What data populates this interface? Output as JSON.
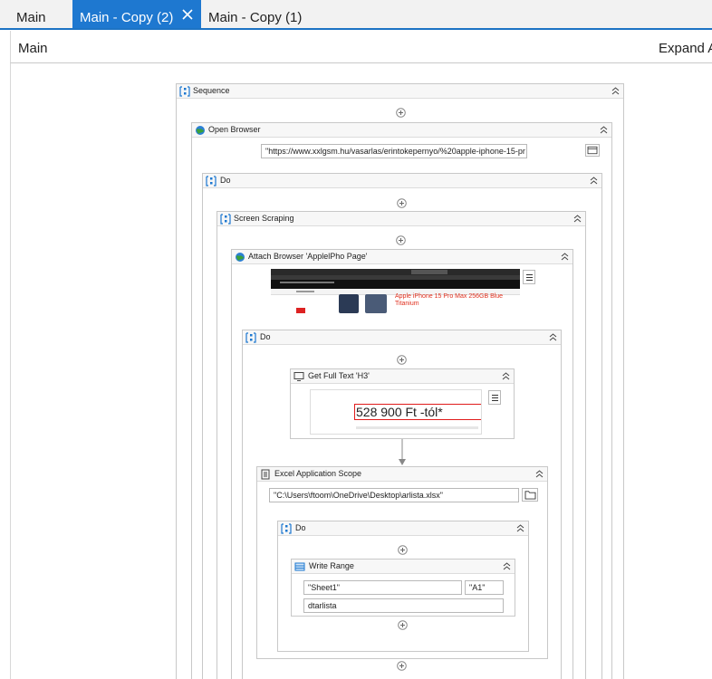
{
  "tabs": [
    {
      "label": "Main",
      "active": false
    },
    {
      "label": "Main - Copy (2)",
      "active": true
    },
    {
      "label": "Main - Copy (1)",
      "active": false
    }
  ],
  "header": {
    "title": "Main",
    "expand_label": "Expand A"
  },
  "workflow": {
    "sequence": {
      "title": "Sequence"
    },
    "open_browser": {
      "title": "Open Browser",
      "url_value": "\"https://www.xxlgsm.hu/vasarlas/erintokepernyo/%20apple-iphone-15-pr"
    },
    "do_1": {
      "title": "Do"
    },
    "screen_scraping": {
      "title": "Screen Scraping"
    },
    "attach_browser": {
      "title": "Attach Browser 'ApplelPho Page'",
      "preview_product_text": "Apple iPhone 15 Pro Max 256GB Blue Titanium"
    },
    "do_2": {
      "title": "Do"
    },
    "get_full_text": {
      "title": "Get Full Text 'H3'",
      "preview_price": "528 900 Ft -tól*"
    },
    "excel_scope": {
      "title": "Excel Application Scope",
      "path_value": "\"C:\\Users\\ftoom\\OneDrive\\Desktop\\arlista.xlsx\""
    },
    "do_3": {
      "title": "Do"
    },
    "write_range": {
      "title": "Write Range",
      "sheet_value": "\"Sheet1\"",
      "cell_value": "\"A1\"",
      "datatable_value": "dtarlista"
    }
  },
  "colors": {
    "accent": "#1e78d0",
    "selection_red": "#e01b1b",
    "border": "#c8c8c8"
  }
}
